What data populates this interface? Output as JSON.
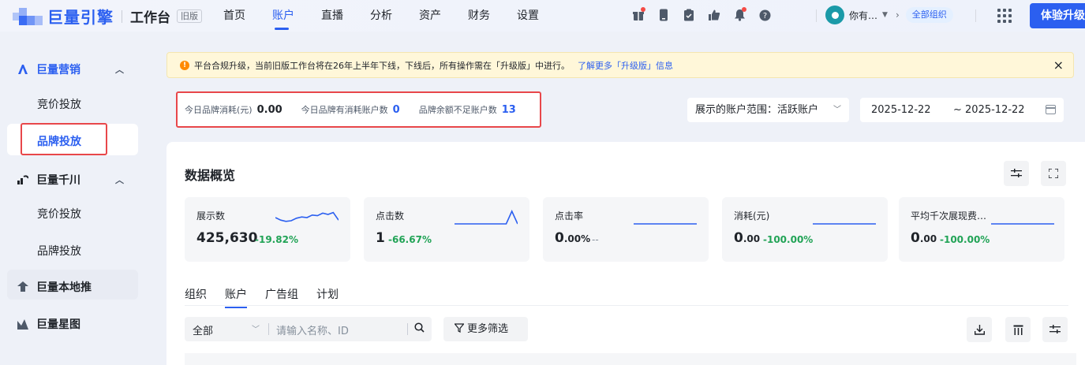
{
  "app": {
    "logo_text": "巨量引擎",
    "workbench": "工作台",
    "old_badge": "旧版",
    "upgrade_label": "体验升级"
  },
  "nav": {
    "items": [
      {
        "label": "首页",
        "active": false
      },
      {
        "label": "账户",
        "active": true
      },
      {
        "label": "直播",
        "active": false
      },
      {
        "label": "分析",
        "active": false
      },
      {
        "label": "资产",
        "active": false
      },
      {
        "label": "财务",
        "active": false
      },
      {
        "label": "设置",
        "active": false
      }
    ]
  },
  "user": {
    "name": "你有…",
    "org": "全部组织"
  },
  "sidebar": {
    "group1": "巨量营销",
    "group1_items": [
      "竞价投放",
      "品牌投放"
    ],
    "group2": "巨量千川",
    "group2_items": [
      "竞价投放",
      "品牌投放"
    ],
    "group3": "巨量本地推",
    "group4": "巨量星图"
  },
  "banner": {
    "text": "平台合规升级，当前旧版工作台将在26年上半年下线，下线后，所有操作需在「升级版」中进行。",
    "link": "了解更多「升级版」信息",
    "close": "×"
  },
  "stats": {
    "consume_label": "今日品牌消耗(元)",
    "consume_value": "0.00",
    "accounts_label": "今日品牌有消耗账户数",
    "accounts_value": "0",
    "low_balance_label": "品牌余额不足账户数",
    "low_balance_value": "13"
  },
  "filters": {
    "range_label": "展示的账户范围：活跃账户",
    "date_start": "2025-12-22",
    "date_end": "~ 2025-12-22"
  },
  "overview": {
    "title": "数据概览",
    "metrics": [
      {
        "label": "展示数",
        "value": "425,630",
        "change": "-19.82%",
        "trend": [
          0.5,
          0.3,
          0.2,
          0.25,
          0.45,
          0.55,
          0.5,
          0.7,
          0.65,
          0.85,
          0.75,
          0.9,
          0.3
        ]
      },
      {
        "label": "点击数",
        "value": "1",
        "change": "-66.67%",
        "trend": [
          0,
          0,
          0,
          0,
          0,
          0,
          0,
          0,
          0,
          0,
          1,
          0
        ]
      },
      {
        "label": "点击率",
        "value_main": "0",
        "value_small": ".00%",
        "change": "--",
        "trend": [
          0,
          0,
          0,
          0,
          0,
          0
        ]
      },
      {
        "label": "消耗(元)",
        "value_main": "0",
        "value_small": ".00",
        "change": "-100.00%",
        "trend": [
          0,
          0,
          0,
          0,
          0,
          0
        ]
      },
      {
        "label": "平均千次展现费…",
        "value_main": "0",
        "value_small": ".00",
        "change": "-100.00%",
        "trend": [
          0,
          0,
          0,
          0,
          0,
          0
        ]
      }
    ]
  },
  "tabs": [
    {
      "label": "组织",
      "active": false
    },
    {
      "label": "账户",
      "active": true
    },
    {
      "label": "广告组",
      "active": false
    },
    {
      "label": "计划",
      "active": false
    }
  ],
  "table_filter": {
    "scope": "全部",
    "placeholder": "请输入名称、ID",
    "more": "更多筛选"
  },
  "colors": {
    "brand": "#2b5ff0",
    "highlight_box": "#e8474a",
    "positive_change": "#21a356"
  }
}
